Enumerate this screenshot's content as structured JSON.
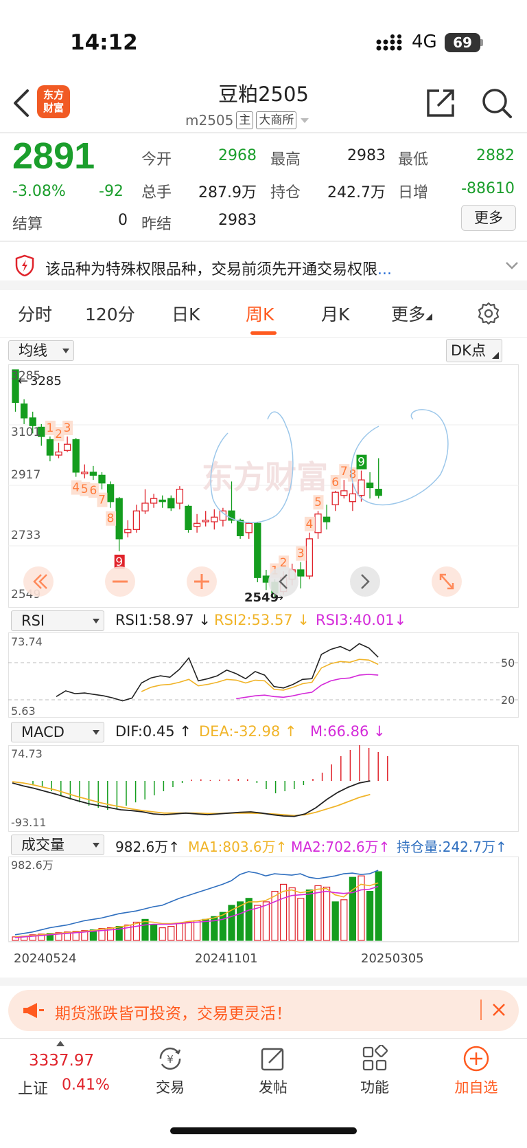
{
  "status": {
    "time": "14:12",
    "network": "4G",
    "battery": "69"
  },
  "header": {
    "title": "豆粕2505",
    "code": "m2505",
    "tag_main": "主",
    "exchange": "大商所",
    "logo_line1": "东方",
    "logo_line2": "财富"
  },
  "quote": {
    "price": "2891",
    "change_pct": "-3.08%",
    "change_abs": "-92",
    "fields": {
      "open_label": "今开",
      "open": "2968",
      "high_label": "最高",
      "high": "2983",
      "low_label": "最低",
      "low": "2882",
      "volume_label": "总手",
      "volume": "287.9万",
      "oi_label": "持仓",
      "oi": "242.7万",
      "daily_inc_label": "日增",
      "daily_inc": "-88610",
      "settle_label": "结算",
      "settle": "0",
      "prev_settle_label": "昨结",
      "prev_settle": "2983"
    },
    "more_label": "更多"
  },
  "notice": {
    "text": "该品种为特殊权限品种，交易前须先开通交易权限",
    "ellipsis": "..."
  },
  "tabs": [
    {
      "label": "分时",
      "active": false
    },
    {
      "label": "120分",
      "active": false
    },
    {
      "label": "日K",
      "active": false
    },
    {
      "label": "周K",
      "active": true
    },
    {
      "label": "月K",
      "active": false
    },
    {
      "label": "更多",
      "active": false
    }
  ],
  "main_chart": {
    "selector": "均线",
    "dk_label": "DK点",
    "watermark": "东方财富",
    "y_labels": [
      "3285",
      "3101",
      "2917",
      "2733",
      "2549"
    ],
    "high_marker": "3285",
    "low_marker": "2549"
  },
  "rsi": {
    "selector": "RSI",
    "rsi1": "RSI1:58.97",
    "rsi2": "RSI2:53.57",
    "rsi3": "RSI3:40.01",
    "y_top": "73.74",
    "y_bottom": "5.63",
    "ref_high": "50",
    "ref_low": "20"
  },
  "macd": {
    "selector": "MACD",
    "dif": "DIF:0.45",
    "dea": "DEA:-32.98",
    "m": "M:66.86",
    "y_top": "74.73",
    "y_bottom": "-93.11"
  },
  "volume": {
    "selector": "成交量",
    "current": "982.6万",
    "ma1": "MA1:803.6万",
    "ma2": "MA2:702.6万",
    "oi": "持仓量:242.7万",
    "y_top": "982.6万"
  },
  "x_labels": [
    "20240524",
    "20241101",
    "20250305"
  ],
  "colors": {
    "up": "#e0232b",
    "down": "#149d1e",
    "accent": "#ff5a1f"
  },
  "chart_data": {
    "type": "candlestick",
    "ylim": [
      2549,
      3285
    ],
    "candles": [
      {
        "o": 3285,
        "c": 3180,
        "h": 3285,
        "l": 3150
      },
      {
        "o": 3175,
        "c": 3130,
        "h": 3190,
        "l": 3110
      },
      {
        "o": 3130,
        "c": 3105,
        "h": 3150,
        "l": 3080
      },
      {
        "o": 3100,
        "c": 3070,
        "h": 3110,
        "l": 3040
      },
      {
        "o": 3060,
        "c": 3010,
        "h": 3070,
        "l": 2990
      },
      {
        "o": 3010,
        "c": 3020,
        "h": 3050,
        "l": 3000
      },
      {
        "o": 3025,
        "c": 3045,
        "h": 3070,
        "l": 3020
      },
      {
        "o": 3060,
        "c": 2955,
        "h": 3065,
        "l": 2940
      },
      {
        "o": 2950,
        "c": 2955,
        "h": 2980,
        "l": 2935
      },
      {
        "o": 2955,
        "c": 2945,
        "h": 2975,
        "l": 2930
      },
      {
        "o": 2945,
        "c": 2920,
        "h": 2955,
        "l": 2900
      },
      {
        "o": 2915,
        "c": 2860,
        "h": 2925,
        "l": 2840
      },
      {
        "o": 2870,
        "c": 2740,
        "h": 2875,
        "l": 2700
      },
      {
        "o": 2760,
        "c": 2770,
        "h": 2800,
        "l": 2745
      },
      {
        "o": 2770,
        "c": 2830,
        "h": 2850,
        "l": 2760
      },
      {
        "o": 2830,
        "c": 2855,
        "h": 2900,
        "l": 2820
      },
      {
        "o": 2855,
        "c": 2870,
        "h": 2885,
        "l": 2840
      },
      {
        "o": 2865,
        "c": 2860,
        "h": 2880,
        "l": 2840
      },
      {
        "o": 2870,
        "c": 2840,
        "h": 2880,
        "l": 2830
      },
      {
        "o": 2855,
        "c": 2900,
        "h": 2910,
        "l": 2835
      },
      {
        "o": 2845,
        "c": 2770,
        "h": 2850,
        "l": 2760
      },
      {
        "o": 2780,
        "c": 2790,
        "h": 2820,
        "l": 2760
      },
      {
        "o": 2795,
        "c": 2800,
        "h": 2830,
        "l": 2780
      },
      {
        "o": 2795,
        "c": 2810,
        "h": 2835,
        "l": 2770
      },
      {
        "o": 2800,
        "c": 2830,
        "h": 2840,
        "l": 2780
      },
      {
        "o": 2830,
        "c": 2800,
        "h": 2925,
        "l": 2790
      },
      {
        "o": 2800,
        "c": 2750,
        "h": 2805,
        "l": 2740
      },
      {
        "o": 2760,
        "c": 2790,
        "h": 2795,
        "l": 2740
      },
      {
        "o": 2790,
        "c": 2615,
        "h": 2795,
        "l": 2600
      },
      {
        "o": 2620,
        "c": 2600,
        "h": 2640,
        "l": 2575
      },
      {
        "o": 2600,
        "c": 2565,
        "h": 2610,
        "l": 2549
      },
      {
        "o": 2570,
        "c": 2615,
        "h": 2635,
        "l": 2560
      },
      {
        "o": 2610,
        "c": 2640,
        "h": 2660,
        "l": 2590
      },
      {
        "o": 2640,
        "c": 2620,
        "h": 2665,
        "l": 2580
      },
      {
        "o": 2620,
        "c": 2740,
        "h": 2760,
        "l": 2610
      },
      {
        "o": 2760,
        "c": 2820,
        "h": 2830,
        "l": 2740
      },
      {
        "o": 2810,
        "c": 2795,
        "h": 2850,
        "l": 2770
      },
      {
        "o": 2850,
        "c": 2890,
        "h": 2895,
        "l": 2830
      },
      {
        "o": 2880,
        "c": 2895,
        "h": 2930,
        "l": 2870
      },
      {
        "o": 2860,
        "c": 2885,
        "h": 2920,
        "l": 2830
      },
      {
        "o": 2880,
        "c": 2930,
        "h": 2960,
        "l": 2860
      },
      {
        "o": 2920,
        "c": 2905,
        "h": 2955,
        "l": 2870
      },
      {
        "o": 2900,
        "c": 2880,
        "h": 3000,
        "l": 2870
      }
    ],
    "rsi1": [
      18,
      26,
      22,
      23,
      21,
      19,
      16,
      12,
      16,
      37,
      44,
      47,
      45,
      56,
      72,
      40,
      43,
      47,
      55,
      50,
      43,
      53,
      48,
      32,
      30,
      35,
      42,
      43,
      77,
      84,
      88,
      82,
      92,
      86,
      73
    ],
    "rsi2": [
      null,
      null,
      null,
      null,
      null,
      null,
      null,
      null,
      null,
      25,
      31,
      34,
      35,
      38,
      42,
      33,
      35,
      38,
      42,
      41,
      37,
      41,
      40,
      28,
      27,
      31,
      36,
      38,
      58,
      64,
      67,
      66,
      70,
      69,
      63
    ],
    "rsi3": [
      null,
      null,
      null,
      null,
      null,
      null,
      null,
      null,
      null,
      null,
      null,
      null,
      null,
      null,
      null,
      null,
      null,
      null,
      null,
      15,
      17,
      19,
      20,
      18,
      17,
      19,
      22,
      24,
      34,
      40,
      43,
      44,
      48,
      49,
      48
    ],
    "macd_bar": [
      -10,
      -15,
      -25,
      -35,
      -45,
      -52,
      -60,
      -65,
      -70,
      -68,
      -60,
      -52,
      -45,
      -35,
      -25,
      -15,
      -5,
      3,
      4,
      2,
      3,
      4,
      5,
      4,
      -5,
      -20,
      -30,
      -25,
      -20,
      -10,
      5,
      20,
      40,
      60,
      75,
      90,
      80,
      70,
      60
    ],
    "macd_dif": [
      -5,
      -12,
      -18,
      -25,
      -32,
      -40,
      -48,
      -55,
      -60,
      -65,
      -70,
      -72,
      -75,
      -80,
      -82,
      -80,
      -78,
      -80,
      -82,
      -80,
      -78,
      -76,
      -75,
      -78,
      -82,
      -85,
      -86,
      -80,
      -65,
      -45,
      -28,
      -15,
      -5,
      0
    ],
    "macd_dea": [
      -2,
      -5,
      -10,
      -16,
      -22,
      -30,
      -38,
      -45,
      -52,
      -58,
      -63,
      -68,
      -72,
      -75,
      -78,
      -78,
      -78,
      -78,
      -79,
      -79,
      -78,
      -78,
      -78,
      -79,
      -80,
      -82,
      -84,
      -82,
      -76,
      -68,
      -60,
      -50,
      -40,
      -33
    ],
    "volume_values": [
      5,
      6,
      8,
      9,
      10,
      11,
      12,
      13,
      14,
      15,
      17,
      18,
      20,
      22,
      26,
      30,
      22,
      18,
      20,
      24,
      26,
      28,
      30,
      34,
      40,
      50,
      55,
      60,
      50,
      55,
      70,
      80,
      75,
      60,
      72,
      78,
      76,
      55,
      58,
      90,
      92,
      70,
      98
    ],
    "volume_up": [
      true,
      true,
      true,
      true,
      false,
      true,
      true,
      true,
      true,
      false,
      true,
      true,
      false,
      true,
      true,
      false,
      false,
      true,
      true,
      true,
      true,
      true,
      false,
      false,
      false,
      false,
      false,
      false,
      true,
      true,
      true,
      true,
      true,
      true,
      false,
      true,
      true,
      false,
      true,
      false,
      true,
      false,
      false
    ],
    "volume_ma1": [
      5,
      6,
      7,
      8,
      9,
      10,
      11,
      12,
      13,
      14,
      16,
      17,
      19,
      21,
      24,
      27,
      26,
      24,
      24,
      25,
      27,
      28,
      30,
      32,
      36,
      43,
      49,
      55,
      55,
      57,
      63,
      70,
      72,
      68,
      70,
      73,
      74,
      65,
      62,
      72,
      80,
      78,
      82
    ],
    "volume_ma2": [
      4,
      5,
      6,
      7,
      8,
      9,
      10,
      11,
      12,
      13,
      14,
      15,
      16,
      18,
      20,
      22,
      23,
      23,
      23,
      24,
      25,
      26,
      27,
      28,
      30,
      34,
      38,
      43,
      46,
      50,
      55,
      60,
      64,
      65,
      66,
      68,
      70,
      68,
      67,
      68,
      72,
      73,
      77
    ],
    "oi_line": [
      8,
      10,
      12,
      15,
      18,
      20,
      22,
      25,
      28,
      30,
      32,
      35,
      38,
      40,
      42,
      45,
      48,
      50,
      55,
      60,
      64,
      68,
      72,
      76,
      80,
      85,
      94,
      98,
      96,
      92,
      95,
      94,
      93,
      95,
      90,
      88,
      90,
      92,
      95,
      96,
      94,
      95,
      100
    ]
  },
  "promo": {
    "text": "期货涨跌皆可投资，交易更灵活！"
  },
  "bottom": {
    "index_value": "3337.97",
    "index_name": "上证",
    "index_pct": "0.41%",
    "nav": [
      {
        "label": "交易"
      },
      {
        "label": "发帖"
      },
      {
        "label": "功能"
      },
      {
        "label": "加自选"
      }
    ]
  }
}
